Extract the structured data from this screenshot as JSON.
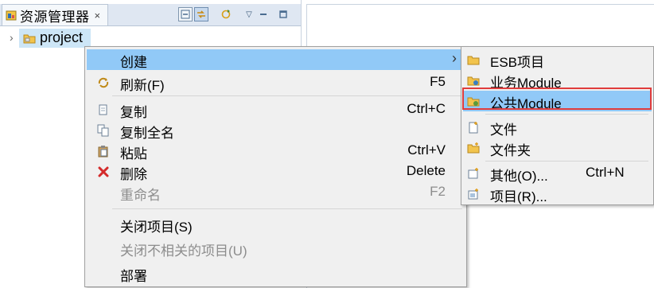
{
  "explorer": {
    "title": "资源管理器",
    "close_glyph": "×",
    "toolbar": [
      "collapse-all-icon",
      "link-with-editor-icon",
      "sync-icon",
      "view-menu-icon",
      "minimize-icon",
      "maximize-icon"
    ],
    "tree": [
      {
        "label": "project",
        "expanded": false,
        "selected": true
      }
    ]
  },
  "context_menu": {
    "items": [
      {
        "label": "创建",
        "shortcut": "",
        "icon": "",
        "submenu_arrow": "›",
        "highlighted": true,
        "disabled": false
      },
      {
        "label": "刷新(F)",
        "shortcut": "F5",
        "icon": "refresh-icon",
        "disabled": false
      },
      {
        "label": "复制",
        "shortcut": "Ctrl+C",
        "icon": "copy-icon",
        "disabled": false
      },
      {
        "label": "复制全名",
        "shortcut": "",
        "icon": "copy-qualified-name-icon",
        "disabled": false
      },
      {
        "label": "粘贴",
        "shortcut": "Ctrl+V",
        "icon": "paste-icon",
        "disabled": false
      },
      {
        "label": "删除",
        "shortcut": "Delete",
        "icon": "delete-icon",
        "disabled": false
      },
      {
        "label": "重命名",
        "shortcut": "F2",
        "icon": "",
        "disabled": true
      },
      {
        "label": "关闭项目(S)",
        "shortcut": "",
        "icon": "",
        "disabled": false
      },
      {
        "label": "关闭不相关的项目(U)",
        "shortcut": "",
        "icon": "",
        "disabled": true
      },
      {
        "label": "部署",
        "shortcut": "",
        "icon": "",
        "disabled": false
      }
    ]
  },
  "submenu": {
    "items": [
      {
        "label": "ESB项目",
        "shortcut": "",
        "icon": "esb-project-icon"
      },
      {
        "label": "业务Module",
        "shortcut": "",
        "icon": "business-module-icon"
      },
      {
        "label": "公共Module",
        "shortcut": "",
        "icon": "common-module-icon",
        "highlighted": true
      },
      {
        "label": "文件",
        "shortcut": "",
        "icon": "new-file-icon"
      },
      {
        "label": "文件夹",
        "shortcut": "",
        "icon": "new-folder-icon"
      },
      {
        "label": "其他(O)...",
        "shortcut": "Ctrl+N",
        "icon": "other-wizard-icon"
      },
      {
        "label": "项目(R)...",
        "shortcut": "",
        "icon": "new-project-icon"
      }
    ]
  },
  "colors": {
    "menu_bg": "#f0f0f0",
    "menu_highlight": "#91c9f7",
    "selection": "#cde6f7",
    "annotation_box": "#e03c3c",
    "disabled_text": "#8d8d8d",
    "delete_icon": "#d42b2b"
  }
}
